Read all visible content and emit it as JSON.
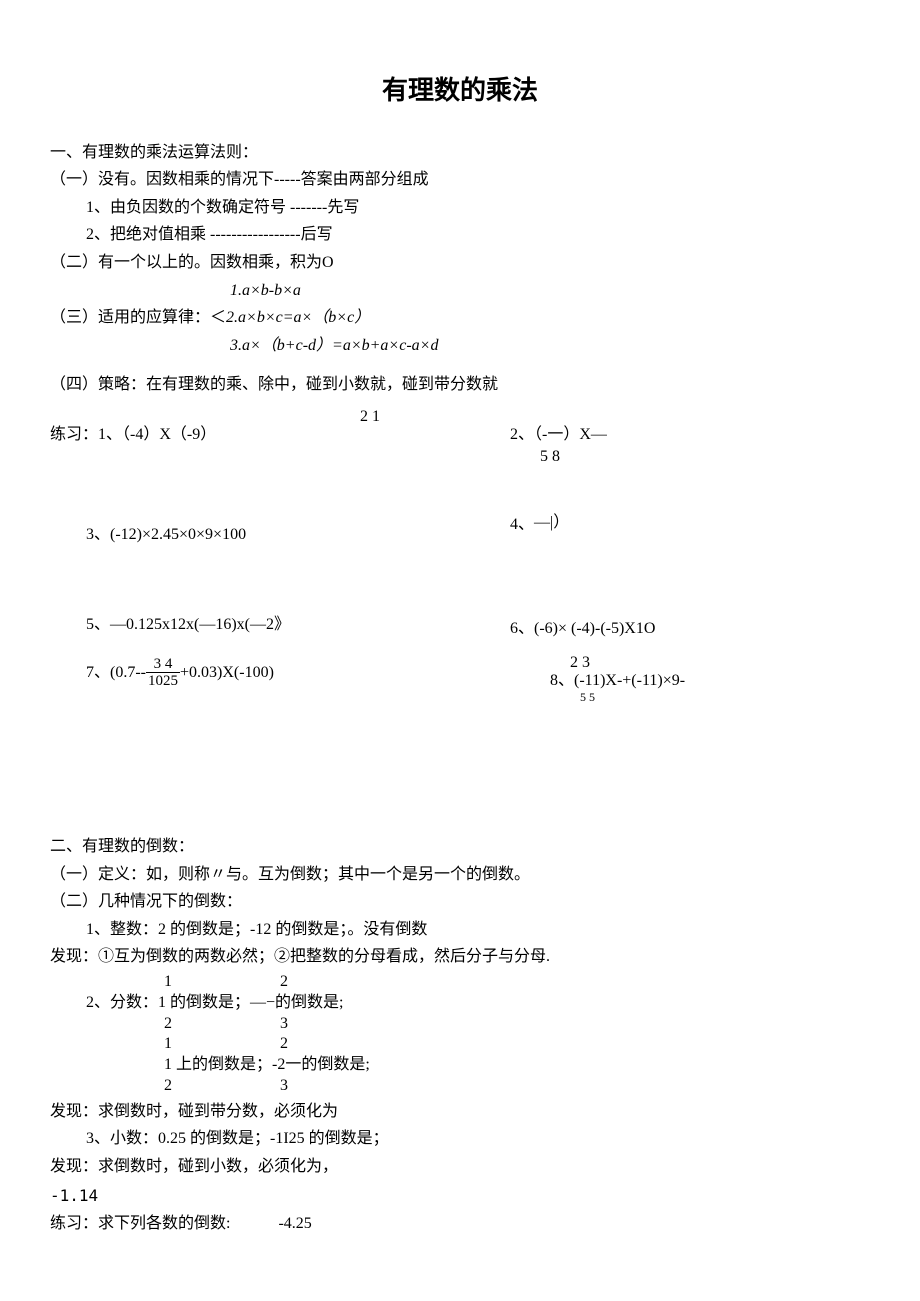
{
  "title": "有理数的乘法",
  "sec1": {
    "head": "一、有理数的乘",
    "head_tail": "法运算法则：",
    "i1_a": "（一）没有。因数相乘的情况下-----",
    "i1_b": "答案由两部分组成",
    "r1a": "1、由负因数的个数确定符号 -------",
    "r1b": "先写",
    "r2a": "2、把绝对值相乘 -----------------",
    "r2b": "后写",
    "i2": "（二）有一个以上的。因数相乘，积为O",
    "e1": "1.a×b-b×a",
    "i3": "（三）适用的应算律：＜2.a×b×c=a×（b×c）",
    "e3": "3.a×（b+c-d）=a×b+a×c-a×d",
    "i4": "（四）策略：在有理数的乘、除中，碰到小数就，碰到带分数就",
    "prac_label": "练习：1、（-4）X（-9）"
  },
  "problems": {
    "p2a": "2、（-一）X—",
    "p2_top": "2       1",
    "p2_bot": "5       8",
    "p3": "3、(-12)×2.45×0×9×100",
    "p4": "4、",
    "p4b": "—|）",
    "p5": "5、—0.125x12x(—16)x(—2》",
    "p6": "6、(-6)×     (-4)-(-5)X1O",
    "p7a": "7、(0.7--",
    "p7_num": "3     4",
    "p7_den": "1025",
    "p7b": "+0.03)X(-100)",
    "p8a": "8、(-11)X-+(-11)×9-",
    "p8_top": "2                3",
    "p8_bot": "5                5"
  },
  "sec2": {
    "head": "二、有理数的倒数：",
    "d1": "（一）定义：如，则称〃与。互为倒数；其中一个是另一个的倒数。",
    "d2": "（二）几种情况下的倒数：",
    "s1a": "1、整数：2 的倒数是；-12 的倒数是；。",
    "s1b": "没有倒数",
    "f1a": "发现：",
    "f1b": "①互为倒数的两数必然；②把整数的分母看成，然后分子与分母.",
    "s2_label": "2、分数：",
    "s2_top": "1                           2",
    "s2_mid_a": "1 的倒数是；—−的倒数是;",
    "s2_bot": "2                           3",
    "s3_top": "1                           2",
    "s3_mid": "1 上的倒数是；-2一的倒数是;",
    "s3_bot": "2                           3",
    "f2a": "发现：",
    "f2b": "求倒数时，碰到带分数，必须化为",
    "s4": "3、小数：0.25 的倒数是；-1I25 的倒数是；",
    "f3a": "发现：",
    "f3b": "求倒数时，碰到小数，必须化为，",
    "neg": "-1.14",
    "prac2": "练习：求下列各数的倒数:",
    "prac2v": "-4.25"
  }
}
